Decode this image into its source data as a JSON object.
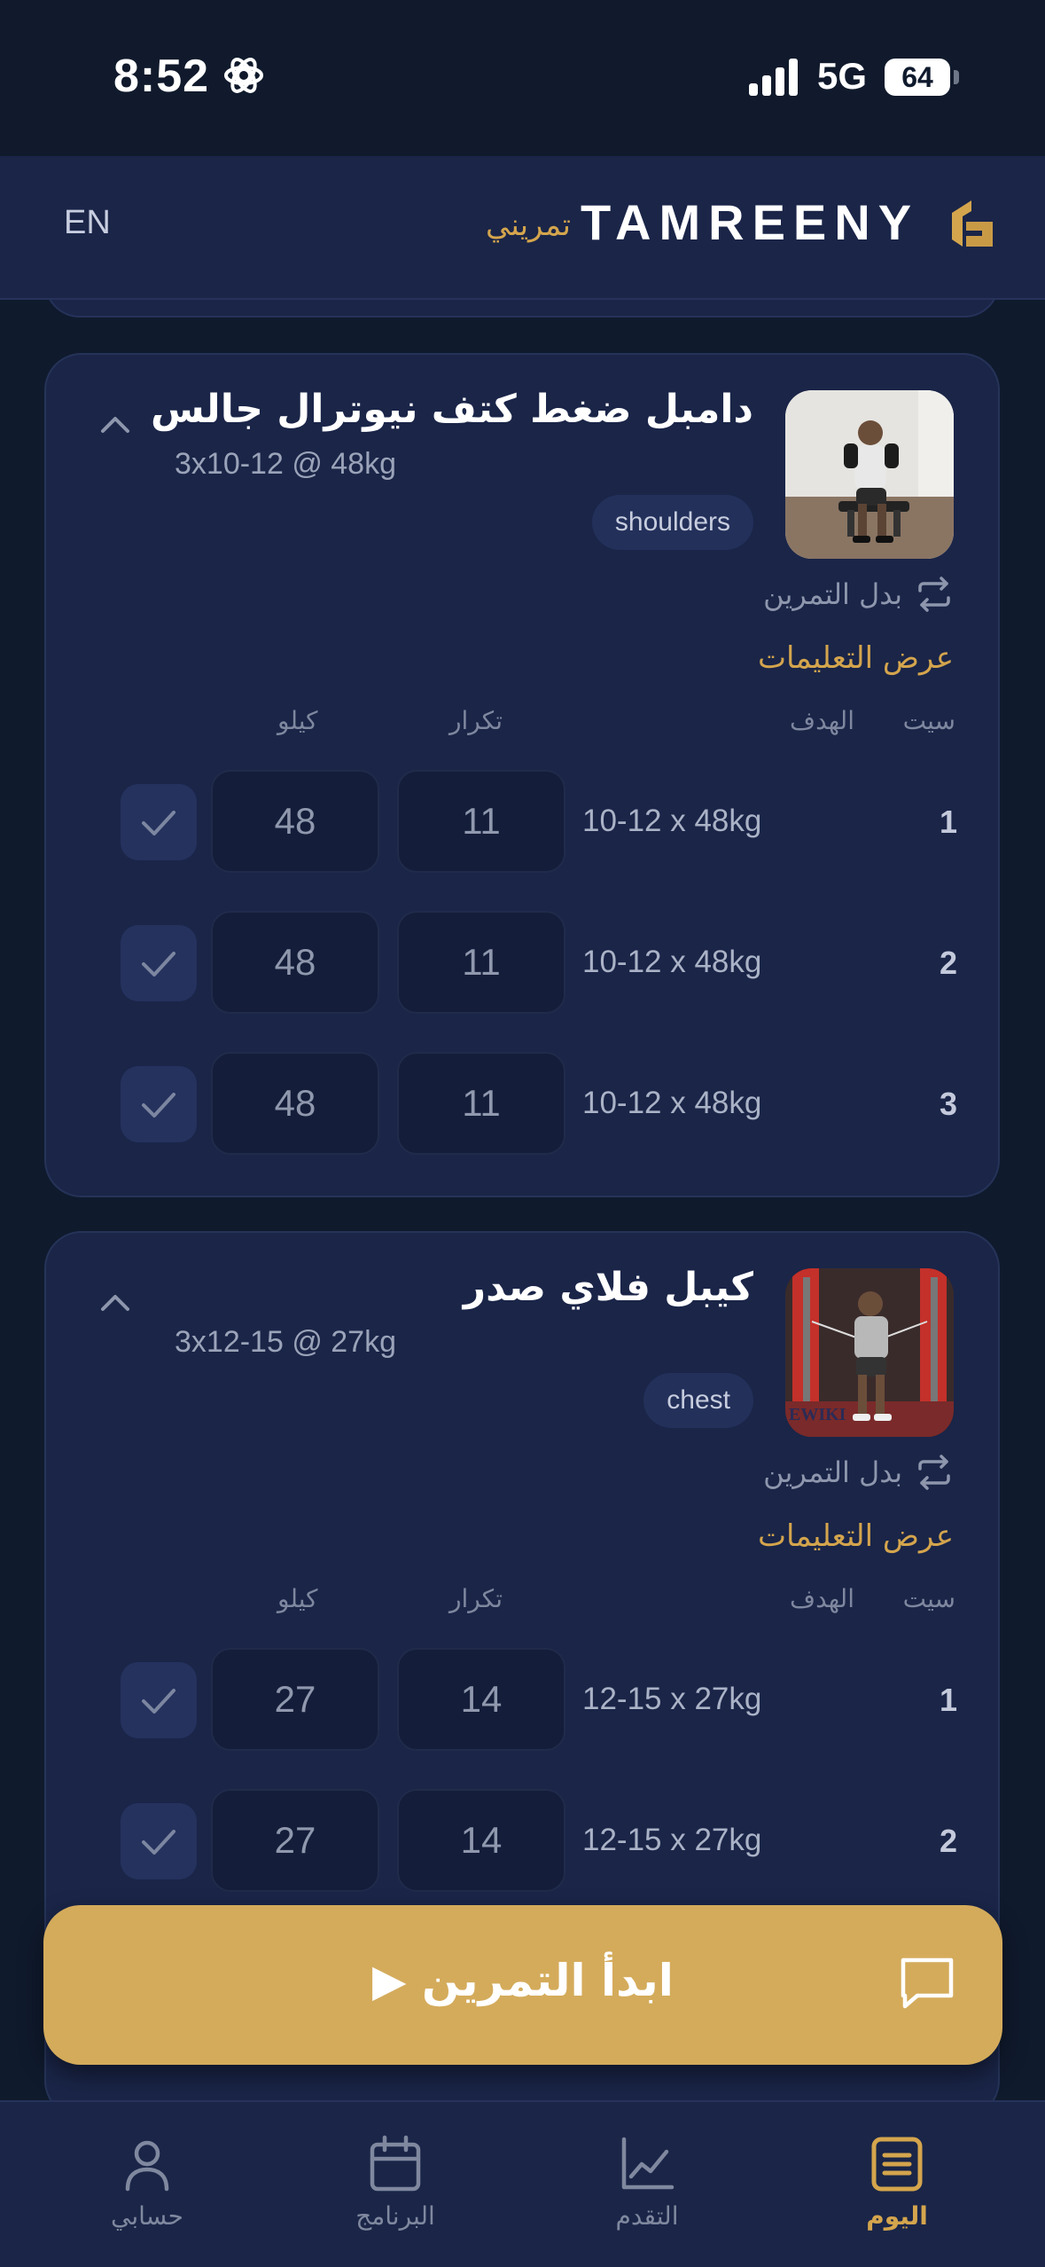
{
  "status_bar": {
    "time": "8:52",
    "network": "5G",
    "battery": "64"
  },
  "header": {
    "lang": "EN",
    "brand": "TAMREENY",
    "brand_ar": "تمريني"
  },
  "columns": {
    "set": "سيت",
    "target": "الهدف",
    "reps": "تكرار",
    "weight": "كيلو"
  },
  "exercises": [
    {
      "title": "دامبل ضغط كتف نيوترال جالس",
      "target": "3x10-12 @ 48kg",
      "tag": "shoulders",
      "swap": "بدل التمرين",
      "instructions": "عرض التعليمات",
      "sets": [
        {
          "num": "1",
          "target": "10-12 x 48kg",
          "reps": "11",
          "weight": "48"
        },
        {
          "num": "2",
          "target": "10-12 x 48kg",
          "reps": "11",
          "weight": "48"
        },
        {
          "num": "3",
          "target": "10-12 x 48kg",
          "reps": "11",
          "weight": "48"
        }
      ]
    },
    {
      "title": "كيبل فلاي صدر",
      "target": "3x12-15 @ 27kg",
      "tag": "chest",
      "swap": "بدل التمرين",
      "instructions": "عرض التعليمات",
      "thumb_caption": "EWIKI",
      "sets": [
        {
          "num": "1",
          "target": "12-15 x 27kg",
          "reps": "14",
          "weight": "27"
        },
        {
          "num": "2",
          "target": "12-15 x 27kg",
          "reps": "14",
          "weight": "27"
        }
      ]
    }
  ],
  "start_button": {
    "label": "ابدأ التمرين ▶"
  },
  "tabs": [
    {
      "label": "حسابي",
      "icon": "person-icon"
    },
    {
      "label": "البرنامج",
      "icon": "calendar-icon"
    },
    {
      "label": "التقدم",
      "icon": "chart-icon"
    },
    {
      "label": "اليوم",
      "icon": "clipboard-icon",
      "active": true
    }
  ],
  "colors": {
    "accent": "#d4a54d",
    "card": "#1a2548",
    "background": "#0f1a2d"
  }
}
